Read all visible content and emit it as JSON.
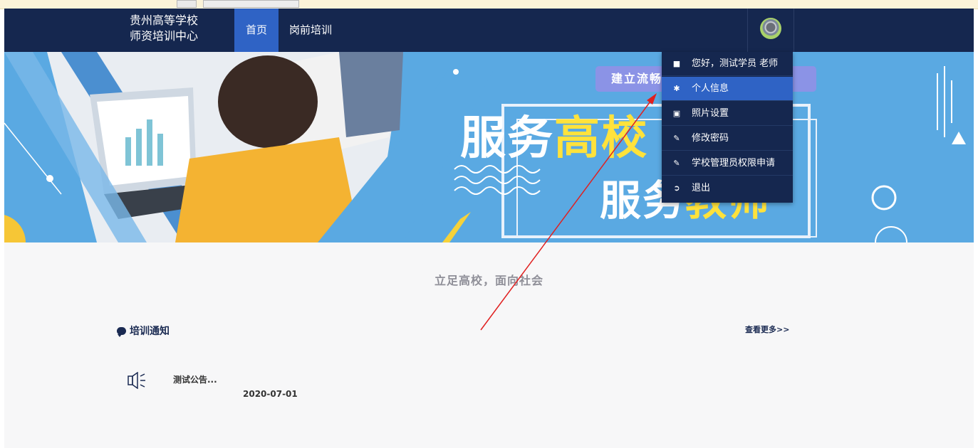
{
  "brand": {
    "line1": "贵州高等学校",
    "line2": "师资培训中心"
  },
  "nav": {
    "home": "首页",
    "training": "岗前培训"
  },
  "dropdown": {
    "items": [
      {
        "label": "您好，测试学员 老师",
        "icon": "user-icon"
      },
      {
        "label": "个人信息",
        "icon": "gear-icon"
      },
      {
        "label": "照片设置",
        "icon": "picture-icon"
      },
      {
        "label": "修改密码",
        "icon": "edit-icon"
      },
      {
        "label": "学校管理员权限申请",
        "icon": "edit-icon"
      },
      {
        "label": "退出",
        "icon": "logout-icon"
      }
    ]
  },
  "banner": {
    "badge": "建立流畅",
    "line1_a": "服务",
    "line1_b": "高校",
    "line2_a": "服务",
    "line2_b": "教师"
  },
  "main": {
    "slogan": "立足高校，面向社会",
    "notice_title": "培训通知",
    "more": "查看更多>>",
    "notice": {
      "title": "测试公告...",
      "date": "2020-07-01"
    }
  },
  "colors": {
    "navbar": "#15274f",
    "accent": "#2f63c5",
    "banner": "#5aa9e2",
    "annotation": "#e02020"
  }
}
